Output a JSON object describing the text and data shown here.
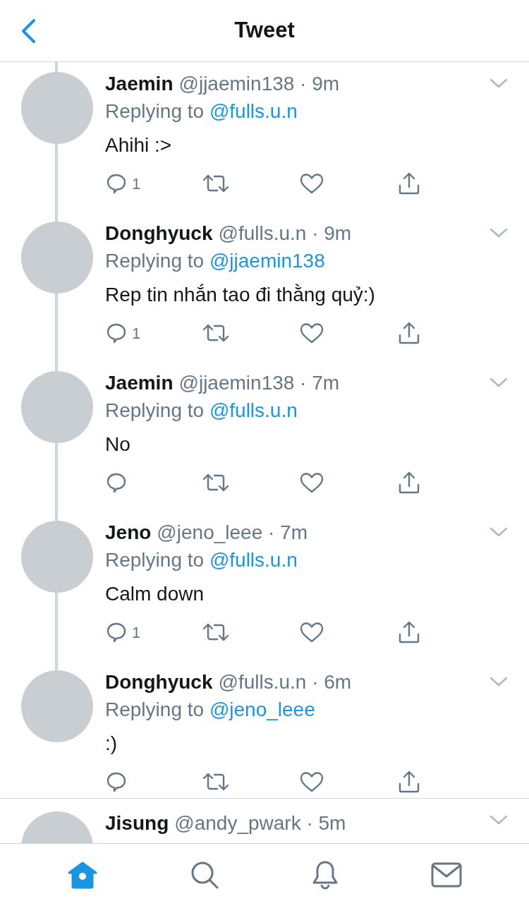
{
  "header": {
    "title": "Tweet"
  },
  "tweets": [
    {
      "name": "Jaemin",
      "handle": "@jjaemin138",
      "time": "· 9m",
      "replying_label": "Replying to",
      "replying_to": "@fulls.u.n",
      "text": "Ahihi :>",
      "reply_count": "1",
      "thread_above": true,
      "thread_below": true
    },
    {
      "name": "Donghyuck",
      "handle": "@fulls.u.n",
      "time": "· 9m",
      "replying_label": "Replying to",
      "replying_to": "@jjaemin138",
      "text": "Rep tin nhắn tao đi thằng quỷ:)",
      "reply_count": "1",
      "thread_above": true,
      "thread_below": true
    },
    {
      "name": "Jaemin",
      "handle": "@jjaemin138",
      "time": "· 7m",
      "replying_label": "Replying to",
      "replying_to": "@fulls.u.n",
      "text": "No",
      "thread_above": true,
      "thread_below": true
    },
    {
      "name": "Jeno",
      "handle": "@jeno_leee",
      "time": "· 7m",
      "replying_label": "Replying to",
      "replying_to": "@fulls.u.n",
      "text": "Calm down",
      "reply_count": "1",
      "thread_above": true,
      "thread_below": true
    },
    {
      "name": "Donghyuck",
      "handle": "@fulls.u.n",
      "time": "· 6m",
      "replying_label": "Replying to",
      "replying_to": "@jeno_leee",
      "text": ":)",
      "thread_above": true,
      "thread_below": false
    },
    {
      "name": "Jisung",
      "handle": "@andy_pwark",
      "time": "· 5m",
      "thread_above": false,
      "thread_below": false
    }
  ],
  "tabbar": [
    {
      "kind": "home",
      "selected": true
    },
    {
      "kind": "search",
      "selected": false
    },
    {
      "kind": "notifications",
      "selected": false
    },
    {
      "kind": "messages",
      "selected": false
    }
  ]
}
